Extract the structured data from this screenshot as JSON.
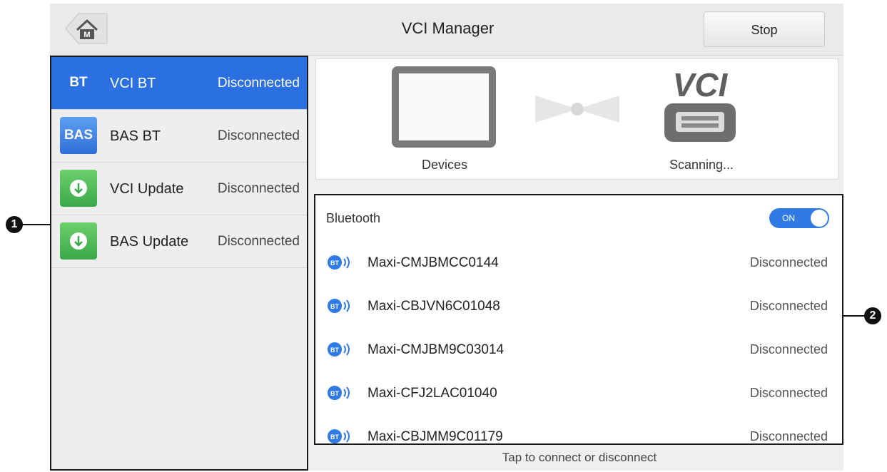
{
  "header": {
    "title": "VCI Manager",
    "home_icon": "home-icon",
    "stop_label": "Stop"
  },
  "sidebar": {
    "items": [
      {
        "icon_text": "BT",
        "label": "VCI BT",
        "status": "Disconnected",
        "active": true
      },
      {
        "icon_text": "BAS",
        "label": "BAS BT",
        "status": "Disconnected",
        "active": false
      },
      {
        "icon": "download-icon",
        "label": "VCI Update",
        "status": "Disconnected",
        "active": false
      },
      {
        "icon": "download-icon",
        "label": "BAS Update",
        "status": "Disconnected",
        "active": false
      }
    ]
  },
  "diagram": {
    "devices_label": "Devices",
    "vci_logo_text": "VCI",
    "scanning_label": "Scanning..."
  },
  "bluetooth": {
    "label": "Bluetooth",
    "toggle_label": "ON",
    "toggle_on": true
  },
  "devices": [
    {
      "name": "Maxi-CMJBMCC0144",
      "status": "Disconnected"
    },
    {
      "name": "Maxi-CBJVN6C01048",
      "status": "Disconnected"
    },
    {
      "name": "Maxi-CMJBM9C03014",
      "status": "Disconnected"
    },
    {
      "name": "Maxi-CFJ2LAC01040",
      "status": "Disconnected"
    },
    {
      "name": "Maxi-CBJMM9C01179",
      "status": "Disconnected"
    }
  ],
  "footer": {
    "hint": "Tap to connect or disconnect"
  },
  "callouts": {
    "one": "1",
    "two": "2"
  },
  "colors": {
    "accent": "#2a70e0",
    "toggle": "#2f7ae5",
    "green": "#4cb956"
  }
}
